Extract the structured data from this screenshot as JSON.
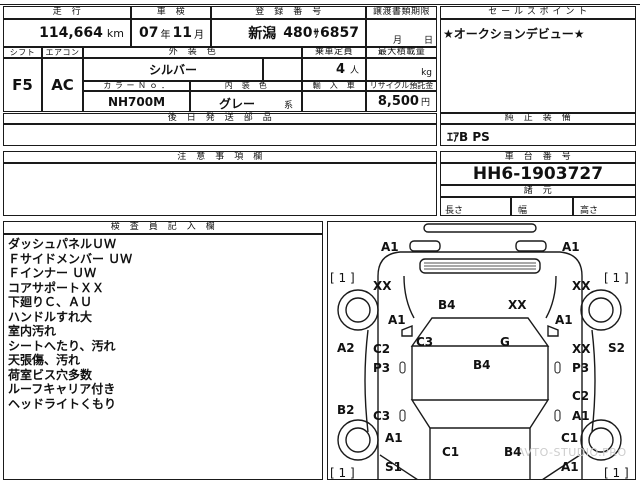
{
  "sheet": {
    "mileage": {
      "label": "走　行",
      "value": "114,664",
      "unit": "km"
    },
    "inspection": {
      "label": "車　検",
      "year": "07",
      "year_unit": "年",
      "month": "11",
      "month_unit": "月"
    },
    "registration": {
      "label": "登　録　番　号",
      "region": "新潟",
      "class_no": "480",
      "kana": "ｻ",
      "number": "6857"
    },
    "transfer_deadline": {
      "label": "譲渡書類期限",
      "month_unit": "月",
      "day_unit": "日"
    },
    "shift": {
      "label": "シフト",
      "value": "F5"
    },
    "aircon": {
      "label": "エアコン",
      "value": "AC"
    },
    "exterior_color": {
      "label": "外　装　色",
      "value": "シルバー"
    },
    "capacity": {
      "label": "乗車定員",
      "value": "4",
      "unit": "人"
    },
    "max_load": {
      "label": "最大積載量",
      "unit": "kg"
    },
    "color_no": {
      "label": "カ ラ ー Ｎ ｏ ．",
      "value": "NH700M"
    },
    "interior_color": {
      "label": "内　装　色",
      "value": "グレー",
      "suffix": "系"
    },
    "import_car": {
      "label": "輸　入　車"
    },
    "recycle_fee": {
      "label": "リサイクル預託金",
      "value": "8,500",
      "unit": "円"
    },
    "later_parts": {
      "label": "後　日　発　送　部　品"
    },
    "notes": {
      "label": "注　意　事　項　欄"
    },
    "inspector": {
      "label": "検　査　員　記　入　欄",
      "lines": [
        "ダッシュパネルＵＷ",
        "Ｆサイドメンバー ＵＷ",
        "Ｆインナー ＵＷ",
        "コアサポートＸＸ",
        "下廻りＣ、ＡＵ",
        "ハンドルすれ大",
        "室内汚れ",
        "シートへたり、汚れ",
        "天張傷、汚れ",
        "荷室ビス穴多数",
        "ルーフキャリア付き",
        "ヘッドライトくもり"
      ]
    }
  },
  "sales_point": {
    "label": "セ ー ル ス ポ イ ン ト",
    "text": "★オークションデビュー★"
  },
  "equipment": {
    "label": "純　正　装　備",
    "value": "ｴｱB PS"
  },
  "chassis": {
    "label": "車　台　番　号",
    "value": "HH6-1903727"
  },
  "specs": {
    "label": "諸　元",
    "length_label": "長さ",
    "width_label": "幅",
    "height_label": "高さ"
  },
  "diagram": {
    "marks": [
      "A1",
      "A1",
      "[ 1 ]",
      "[ 1 ]",
      "XX",
      "XX",
      "B4",
      "XX",
      "A1",
      "A1",
      "C3",
      "G",
      "A2",
      "S2",
      "C2",
      "XX",
      "B4",
      "P3",
      "P3",
      "C2",
      "B2",
      "C3",
      "A1",
      "A1",
      "C1",
      "C1",
      "B4",
      "S1",
      "A1",
      "[ 1 ]",
      "[ 1 ]"
    ]
  },
  "watermark": "AVTO-STUDIO.PRO"
}
